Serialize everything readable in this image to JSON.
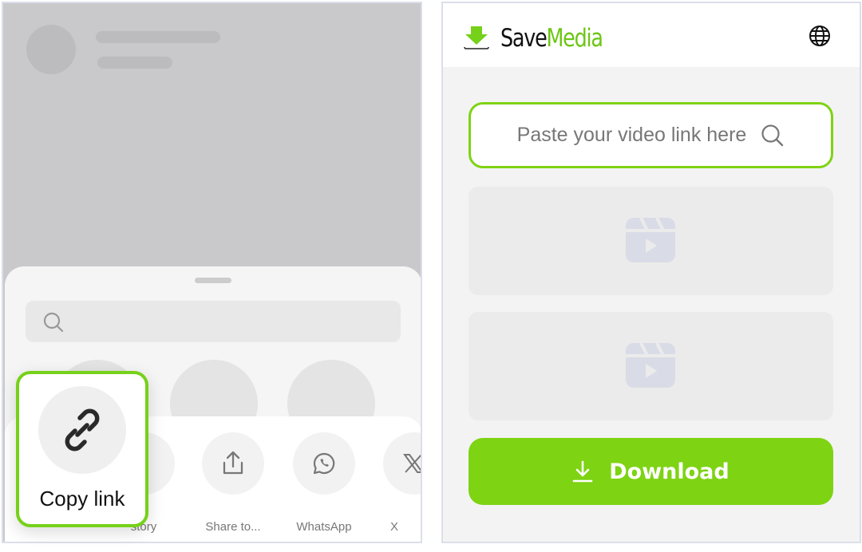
{
  "share_sheet": {
    "search_placeholder": "",
    "actions": [
      {
        "label": "story",
        "icon": "story-icon"
      },
      {
        "label": "Share to...",
        "icon": "share-icon"
      },
      {
        "label": "WhatsApp",
        "icon": "whatsapp-icon"
      },
      {
        "label": "X",
        "icon": "x-icon"
      }
    ],
    "copy_link": {
      "label": "Copy link",
      "icon": "link-icon"
    }
  },
  "savemedia": {
    "brand_part1": "Save",
    "brand_part2": "Media",
    "input_placeholder": "Paste your video link here",
    "download_label": "Download",
    "colors": {
      "accent": "#7ed313",
      "text": "#111111"
    }
  }
}
